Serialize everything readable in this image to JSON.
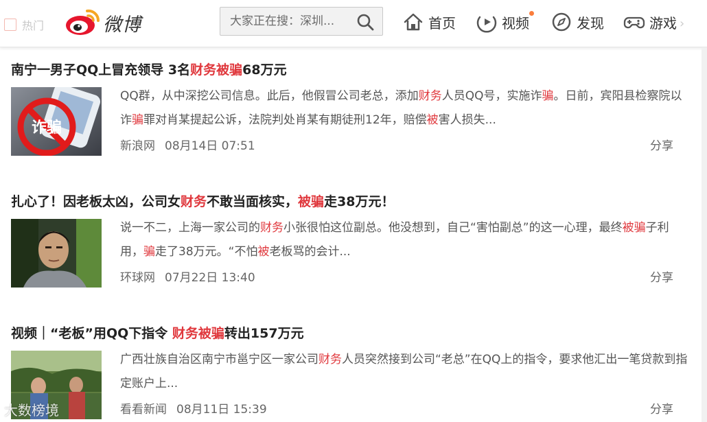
{
  "header": {
    "hot_tab": "热门",
    "logo_text": "微博",
    "search": {
      "placeholder": "大家正在搜：深圳..."
    },
    "nav": [
      {
        "label": "首页",
        "icon": "home-icon"
      },
      {
        "label": "视频",
        "icon": "video-icon",
        "has_dot": true
      },
      {
        "label": "发现",
        "icon": "compass-icon"
      },
      {
        "label": "游戏",
        "icon": "gamepad-icon"
      }
    ],
    "more": "›"
  },
  "colors": {
    "highlight": "#e0393e",
    "brand": "#e6162d",
    "dot": "#fa7d3c"
  },
  "articles": [
    {
      "title_parts": [
        {
          "text": "南宁一男子QQ上冒充领导 3名",
          "hl": false
        },
        {
          "text": "财务被骗",
          "hl": true
        },
        {
          "text": "68万元",
          "hl": false
        }
      ],
      "summary_parts": [
        {
          "text": "QQ群，从中深挖公司信息。此后，他假冒公司老总，添加",
          "hl": false
        },
        {
          "text": "财务",
          "hl": true
        },
        {
          "text": "人员QQ号，实施诈",
          "hl": false
        },
        {
          "text": "骗",
          "hl": true
        },
        {
          "text": "。日前，宾阳县检察院以诈",
          "hl": false
        },
        {
          "text": "骗",
          "hl": true
        },
        {
          "text": "罪对肖某提起公诉，法院判处肖某有期徒刑12年，赔偿",
          "hl": false
        },
        {
          "text": "被",
          "hl": true
        },
        {
          "text": "害人损失...",
          "hl": false
        }
      ],
      "source": "新浪网",
      "time": "08月14日 07:51",
      "share": "分享",
      "thumb_text": "诈骗"
    },
    {
      "title_parts": [
        {
          "text": "扎心了！因老板太凶，公司女",
          "hl": false
        },
        {
          "text": "财务",
          "hl": true
        },
        {
          "text": "不敢当面核实，",
          "hl": false
        },
        {
          "text": "被骗",
          "hl": true
        },
        {
          "text": "走38万元！",
          "hl": false
        }
      ],
      "summary_parts": [
        {
          "text": "说一不二，上海一家公司的",
          "hl": false
        },
        {
          "text": "财务",
          "hl": true
        },
        {
          "text": "小张很怕这位副总。他没想到，自己“害怕副总”的这一心理，最终",
          "hl": false
        },
        {
          "text": "被骗",
          "hl": true
        },
        {
          "text": "子利用，",
          "hl": false
        },
        {
          "text": "骗",
          "hl": true
        },
        {
          "text": "走了38万元。“不怕",
          "hl": false
        },
        {
          "text": "被",
          "hl": true
        },
        {
          "text": "老板骂的会计...",
          "hl": false
        }
      ],
      "source": "环球网",
      "time": "07月22日 13:40",
      "share": "分享"
    },
    {
      "title_parts": [
        {
          "text": "视频｜“老板”用QQ下指令 ",
          "hl": false
        },
        {
          "text": "财务被骗",
          "hl": true
        },
        {
          "text": "转出157万元",
          "hl": false
        }
      ],
      "summary_parts": [
        {
          "text": "广西壮族自治区南宁市邕宁区一家公司",
          "hl": false
        },
        {
          "text": "财务",
          "hl": true
        },
        {
          "text": "人员突然接到公司“老总”在QQ上的指令，要求他汇出一笔贷款到指定账户上...",
          "hl": false
        }
      ],
      "source": "看看新闻",
      "time": "08月11日 15:39",
      "share": "分享"
    }
  ],
  "watermark": "大数榜境"
}
